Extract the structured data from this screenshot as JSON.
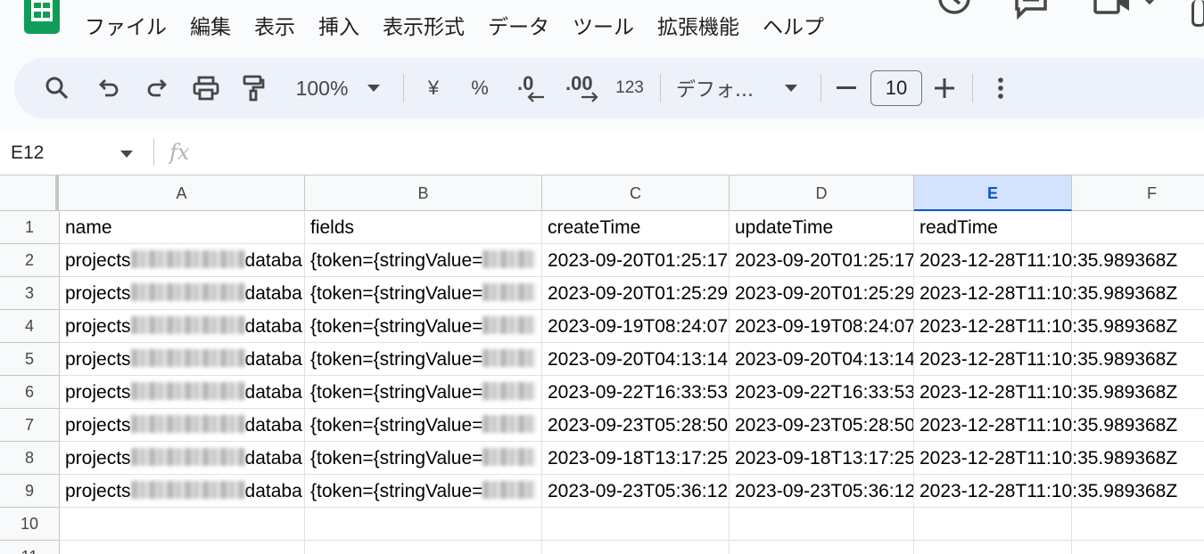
{
  "menu": {
    "items": [
      "ファイル",
      "編集",
      "表示",
      "挿入",
      "表示形式",
      "データ",
      "ツール",
      "拡張機能",
      "ヘルプ"
    ]
  },
  "toolbar": {
    "zoom": "100%",
    "currency": "¥",
    "percent": "%",
    "dec_decrease": ".0",
    "dec_increase": ".00",
    "number_format": "123",
    "font": "デフォ...",
    "font_size": "10"
  },
  "formula_bar": {
    "cell_ref": "E12",
    "fx": "fx"
  },
  "grid": {
    "columns": [
      "A",
      "B",
      "C",
      "D",
      "E",
      "F"
    ],
    "rows": [
      "1",
      "2",
      "3",
      "4",
      "5",
      "6",
      "7",
      "8",
      "9",
      "10",
      "11"
    ],
    "header_row": [
      "name",
      "fields",
      "createTime",
      "updateTime",
      "readTime"
    ],
    "data_rows": [
      {
        "a_prefix": "projects",
        "a_suffix": "databa",
        "b": "{token={stringValue=",
        "c": "2023-09-20T01:25:17",
        "d": "2023-09-20T01:25:17",
        "e": "2023-12-28T11:10:35.989368Z"
      },
      {
        "a_prefix": "projects",
        "a_suffix": "databa",
        "b": "{token={stringValue=",
        "c": "2023-09-20T01:25:29",
        "d": "2023-09-20T01:25:29",
        "e": "2023-12-28T11:10:35.989368Z"
      },
      {
        "a_prefix": "projects",
        "a_suffix": "databa",
        "b": "{token={stringValue=",
        "c": "2023-09-19T08:24:07",
        "d": "2023-09-19T08:24:07",
        "e": "2023-12-28T11:10:35.989368Z"
      },
      {
        "a_prefix": "projects",
        "a_suffix": "databa",
        "b": "{token={stringValue=",
        "c": "2023-09-20T04:13:14",
        "d": "2023-09-20T04:13:14",
        "e": "2023-12-28T11:10:35.989368Z"
      },
      {
        "a_prefix": "projects",
        "a_suffix": "databa",
        "b": "{token={stringValue=",
        "c": "2023-09-22T16:33:53",
        "d": "2023-09-22T16:33:53",
        "e": "2023-12-28T11:10:35.989368Z"
      },
      {
        "a_prefix": "projects",
        "a_suffix": "databa",
        "b": "{token={stringValue=",
        "c": "2023-09-23T05:28:50",
        "d": "2023-09-23T05:28:50",
        "e": "2023-12-28T11:10:35.989368Z"
      },
      {
        "a_prefix": "projects",
        "a_suffix": "databa",
        "b": "{token={stringValue=",
        "c": "2023-09-18T13:17:25",
        "d": "2023-09-18T13:17:25",
        "e": "2023-12-28T11:10:35.989368Z"
      },
      {
        "a_prefix": "projects",
        "a_suffix": "databa",
        "b": "{token={stringValue=",
        "c": "2023-09-23T05:36:12",
        "d": "2023-09-23T05:36:12",
        "e": "2023-12-28T11:10:35.989368Z"
      }
    ],
    "selected_column": "E"
  },
  "colors": {
    "accent": "#0b57d0",
    "selected_header_bg": "#d3e3fd",
    "toolbar_bg": "#edf2fa",
    "sheets_green": "#0f9d58"
  }
}
